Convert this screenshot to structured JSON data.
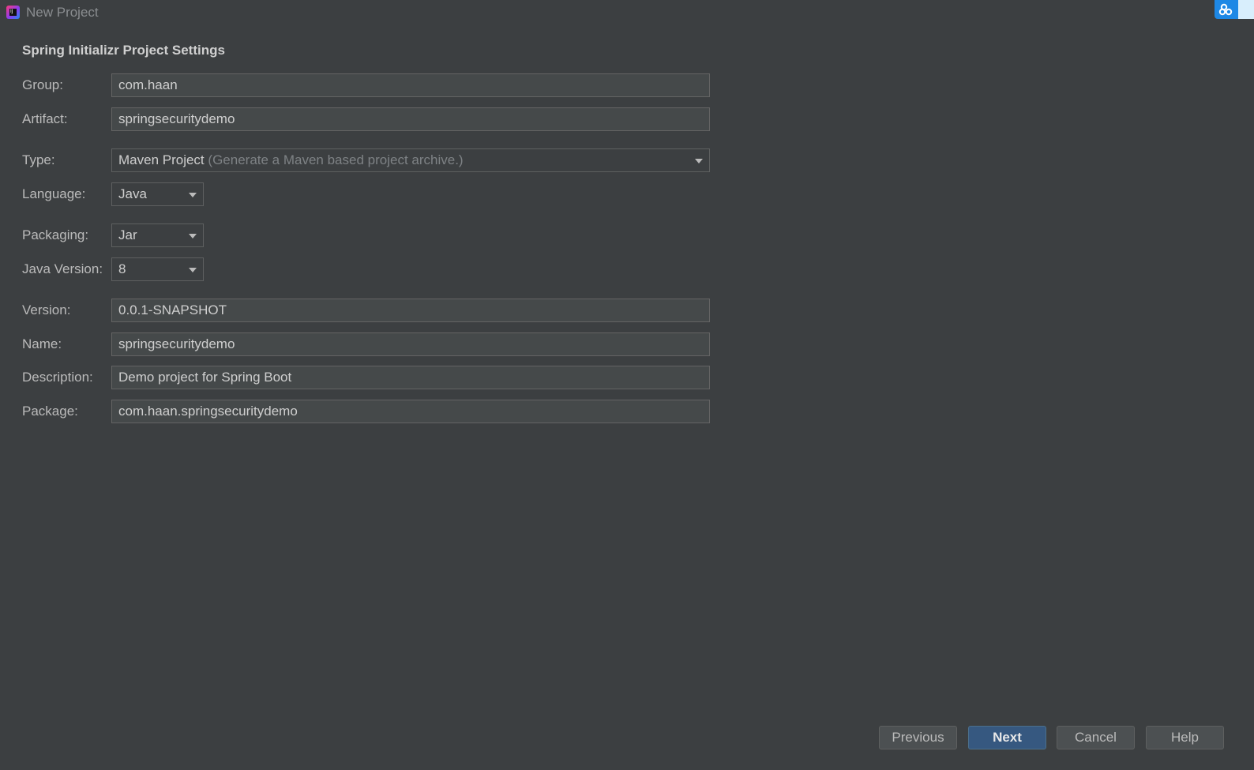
{
  "window": {
    "title": "New Project",
    "app_icon_text": "IJ"
  },
  "section": {
    "title": "Spring Initializr Project Settings"
  },
  "fields": {
    "group": {
      "label": "Group:",
      "value": "com.haan"
    },
    "artifact": {
      "label": "Artifact:",
      "value": "springsecuritydemo"
    },
    "type": {
      "label": "Type:",
      "value": "Maven Project",
      "hint": "(Generate a Maven based project archive.)"
    },
    "language": {
      "label": "Language:",
      "value": "Java"
    },
    "packaging": {
      "label": "Packaging:",
      "value": "Jar"
    },
    "java_version": {
      "label": "Java Version:",
      "value": "8"
    },
    "version": {
      "label": "Version:",
      "value": "0.0.1-SNAPSHOT"
    },
    "name": {
      "label": "Name:",
      "value": "springsecuritydemo"
    },
    "description": {
      "label": "Description:",
      "value": "Demo project for Spring Boot"
    },
    "package": {
      "label": "Package:",
      "value": "com.haan.springsecuritydemo"
    }
  },
  "buttons": {
    "previous": "Previous",
    "next": "Next",
    "cancel": "Cancel",
    "help": "Help"
  },
  "icons": {
    "app": "intellij-idea-icon",
    "corner": "cloud-sync-icon",
    "dropdown": "chevron-down-icon"
  },
  "colors": {
    "background": "#3c3f41",
    "field_background": "#45494a",
    "primary_button": "#365880",
    "corner_widget": "#1e88e5"
  }
}
